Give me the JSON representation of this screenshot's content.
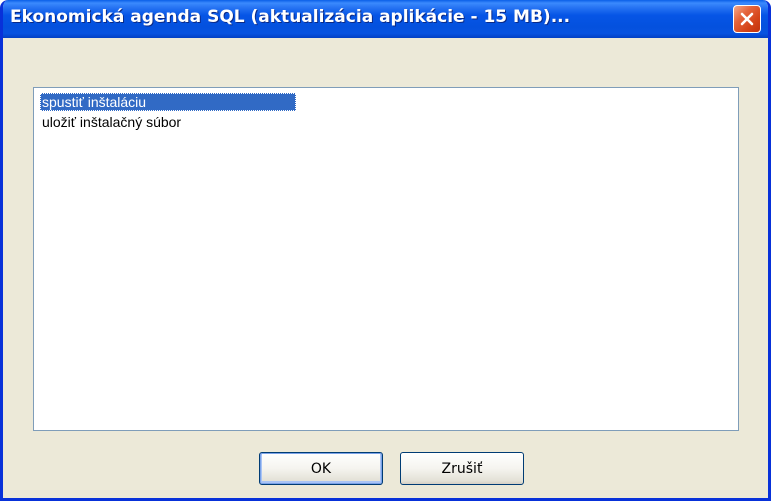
{
  "window": {
    "title": "Ekonomická agenda SQL (aktualizácia aplikácie - 15 MB)...",
    "close_icon": "close-icon"
  },
  "list": {
    "items": [
      {
        "label": "spustiť inštaláciu",
        "selected": true
      },
      {
        "label": "uložiť inštalačný súbor",
        "selected": false
      }
    ]
  },
  "buttons": {
    "ok_label": "OK",
    "cancel_label": "Zrušiť"
  },
  "colors": {
    "titlebar": "#0655e6",
    "close_button": "#d44317",
    "selection": "#316ac5",
    "dialog_background": "#ece9d8"
  }
}
